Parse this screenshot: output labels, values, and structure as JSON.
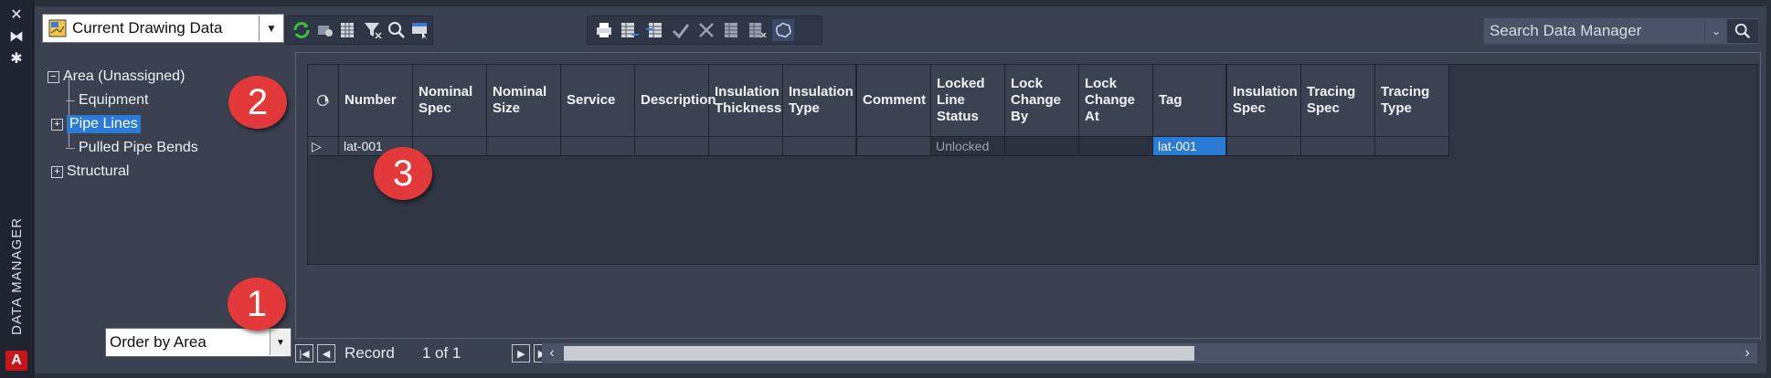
{
  "side": {
    "vertical_label": "DATA MANAGER",
    "logo_letter": "A"
  },
  "data_source": {
    "selected": "Current Drawing Data"
  },
  "search": {
    "placeholder": "Search Data Manager"
  },
  "tree": {
    "root": "Area (Unassigned)",
    "children": [
      "Equipment",
      "Pipe Lines",
      "Pulled Pipe Bends",
      "Structural"
    ],
    "selected": "Pipe Lines"
  },
  "order_by": {
    "selected": "Order by Area"
  },
  "badges": [
    "1",
    "2",
    "3"
  ],
  "grid": {
    "columns": [
      "Number",
      "Nominal Spec",
      "Nominal Size",
      "Service",
      "Description",
      "Insulation Thickness",
      "Insulation Type",
      "Comment",
      "Locked Line Status",
      "Lock Change By",
      "Lock Change At",
      "Tag",
      "Insulation Spec",
      "Tracing Spec",
      "Tracing Type"
    ],
    "rows": [
      [
        "lat-001",
        "",
        "",
        "",
        "",
        "",
        "",
        "",
        "Unlocked",
        "",
        "",
        "lat-001",
        "",
        "",
        ""
      ]
    ]
  },
  "record_nav": {
    "label": "Record",
    "value": "1 of 1"
  },
  "colors": {
    "accent": "#2a7ad6",
    "badge": "#e3393a",
    "panel": "#3a4252"
  }
}
